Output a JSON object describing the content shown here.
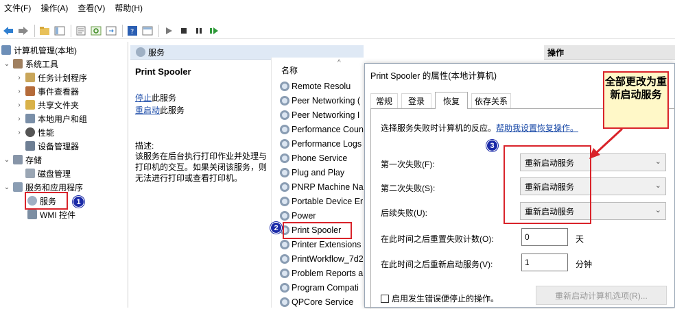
{
  "menu": [
    "文件(F)",
    "操作(A)",
    "查看(V)",
    "帮助(H)"
  ],
  "tree": {
    "root": "计算机管理(本地)",
    "system_tools": "系统工具",
    "task_scheduler": "任务计划程序",
    "event_viewer": "事件查看器",
    "shared_folders": "共享文件夹",
    "local_users": "本地用户和组",
    "performance": "性能",
    "device_manager": "设备管理器",
    "storage": "存储",
    "disk_management": "磁盘管理",
    "services_apps": "服务和应用程序",
    "services": "服务",
    "wmi": "WMI 控件"
  },
  "middle": {
    "header": "服务",
    "service_title": "Print Spooler",
    "stop_link": "停止",
    "stop_suffix": "此服务",
    "restart_link": "重启动",
    "restart_suffix": "此服务",
    "desc_label": "描述:",
    "desc_text": "该服务在后台执行打印作业并处理与打印机的交互。如果关闭该服务，则无法进行打印或查看打印机。",
    "col_name": "名称",
    "services": [
      "Portable Device Er",
      "Power",
      "Print Spooler",
      "Printer Extensions",
      "PrintWorkflow_7d2",
      "Problem Reports a",
      "Program Compati",
      "QPCore Service"
    ],
    "services_top": [
      "Remote Resolu",
      "Peer Networking (",
      "Peer Networking I",
      "Performance Coun",
      "Performance Logs",
      "Phone Service",
      "Plug and Play",
      "PNRP Machine Na"
    ]
  },
  "actions": {
    "header": "操作"
  },
  "dialog": {
    "title": "Print Spooler 的属性(本地计算机)",
    "tabs": [
      "常规",
      "登录",
      "恢复",
      "依存关系"
    ],
    "intro": "选择服务失败时计算机的反应。",
    "help_link": "帮助我设置恢复操作。",
    "first_failure_label": "第一次失败(F):",
    "first_failure_value": "重新启动服务",
    "second_failure_label": "第二次失败(S):",
    "second_failure_value": "重新启动服务",
    "subsequent_label": "后续失败(U):",
    "subsequent_value": "重新启动服务",
    "reset_label": "在此时间之后重置失败计数(O):",
    "reset_value": "0",
    "reset_unit": "天",
    "restart_label": "在此时间之后重新启动服务(V):",
    "restart_value": "1",
    "restart_unit": "分钟",
    "checkbox_label": "启用发生错误便停止的操作。",
    "restart_options_button": "重新启动计算机选项(R)..."
  },
  "annotations": {
    "callout": "全部更改为重新启动服务",
    "badge1": "1",
    "badge2": "2",
    "badge3": "3"
  }
}
